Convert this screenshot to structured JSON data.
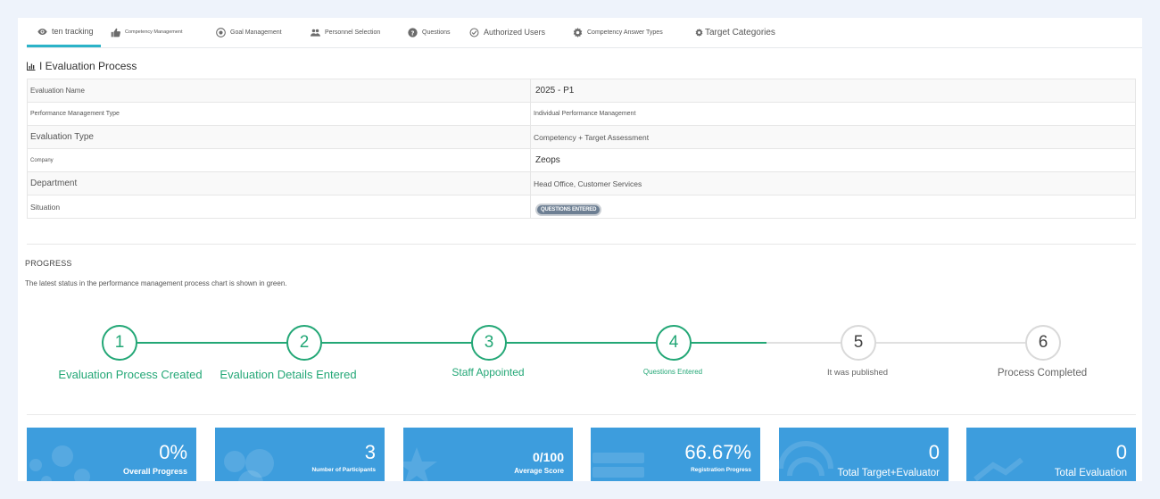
{
  "tabs": [
    {
      "label": "ten tracking",
      "icon": "eye-icon",
      "active": true
    },
    {
      "label": "Competency Management",
      "icon": "thumbs-up-icon",
      "active": false
    },
    {
      "label": "Goal Management",
      "icon": "target-icon",
      "active": false
    },
    {
      "label": "Personnel Selection",
      "icon": "users-icon",
      "active": false
    },
    {
      "label": "Questions",
      "icon": "question-circle-icon",
      "active": false
    },
    {
      "label": "Authorized Users",
      "icon": "check-circle-icon",
      "active": false
    },
    {
      "label": "Competency Answer Types",
      "icon": "gear-icon",
      "active": false
    },
    {
      "label": "Target Categories",
      "icon": "gear-icon",
      "active": false
    }
  ],
  "section": {
    "title": "I Evaluation Process",
    "icon": "bar-chart-icon"
  },
  "details": [
    {
      "label": "Evaluation Name",
      "value": "2025 - P1"
    },
    {
      "label": "Performance Management Type",
      "value": "Individual Performance Management"
    },
    {
      "label": "Evaluation Type",
      "value": "Competency + Target Assessment"
    },
    {
      "label": "Company",
      "value": "Zeops"
    },
    {
      "label": "Department",
      "value": "Head Office, Customer Services"
    },
    {
      "label": "Situation",
      "badge": "QUESTIONS ENTERED"
    }
  ],
  "progress": {
    "title": "PROGRESS",
    "description": "The latest status in the performance management process chart is shown in green.",
    "current_step": 4,
    "steps": [
      {
        "number": "1",
        "label": "Evaluation Process Created",
        "done": true
      },
      {
        "number": "2",
        "label": "Evaluation Details Entered",
        "done": true
      },
      {
        "number": "3",
        "label": "Staff Appointed",
        "done": true
      },
      {
        "number": "4",
        "label": "Questions Entered",
        "done": true
      },
      {
        "number": "5",
        "label": "It was published",
        "done": false
      },
      {
        "number": "6",
        "label": "Process Completed",
        "done": false
      }
    ],
    "colors": {
      "done": "#23a776",
      "pending": "#d9d9d9"
    }
  },
  "stats": [
    {
      "value": "0%",
      "label": "Overall Progress",
      "icon": "bubbles-icon"
    },
    {
      "value": "3",
      "label": "Number of Participants",
      "icon": "users-icon"
    },
    {
      "value": "0/100",
      "label": "Average Score",
      "icon": "star-icon"
    },
    {
      "value": "66.67%",
      "label": "Registration Progress",
      "icon": "server-icon"
    },
    {
      "value": "0",
      "label": "Total Target+Evaluator",
      "icon": "wifi-icon"
    },
    {
      "value": "0",
      "label": "Total Evaluation",
      "icon": "trend-up-icon"
    }
  ],
  "colors": {
    "card": "#3d9ddd",
    "accent_tab": "#2bb3c8"
  }
}
